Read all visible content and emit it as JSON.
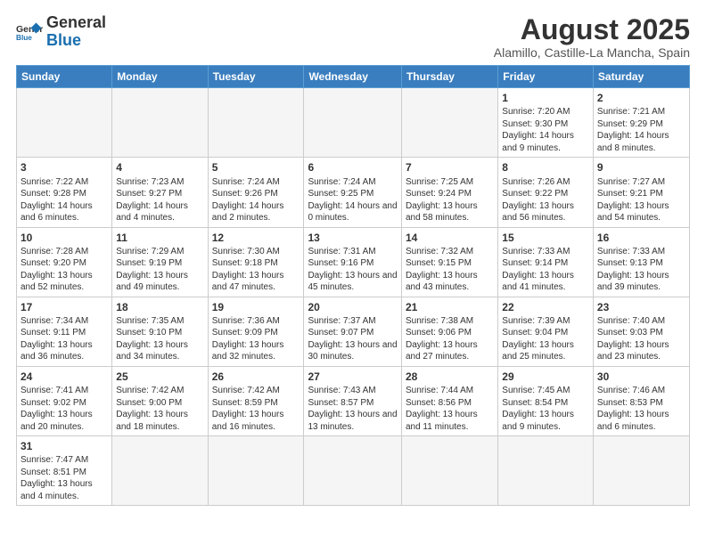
{
  "logo": {
    "text_general": "General",
    "text_blue": "Blue"
  },
  "title": "August 2025",
  "location": "Alamillo, Castille-La Mancha, Spain",
  "weekdays": [
    "Sunday",
    "Monday",
    "Tuesday",
    "Wednesday",
    "Thursday",
    "Friday",
    "Saturday"
  ],
  "weeks": [
    [
      {
        "day": "",
        "info": ""
      },
      {
        "day": "",
        "info": ""
      },
      {
        "day": "",
        "info": ""
      },
      {
        "day": "",
        "info": ""
      },
      {
        "day": "",
        "info": ""
      },
      {
        "day": "1",
        "info": "Sunrise: 7:20 AM\nSunset: 9:30 PM\nDaylight: 14 hours and 9 minutes."
      },
      {
        "day": "2",
        "info": "Sunrise: 7:21 AM\nSunset: 9:29 PM\nDaylight: 14 hours and 8 minutes."
      }
    ],
    [
      {
        "day": "3",
        "info": "Sunrise: 7:22 AM\nSunset: 9:28 PM\nDaylight: 14 hours and 6 minutes."
      },
      {
        "day": "4",
        "info": "Sunrise: 7:23 AM\nSunset: 9:27 PM\nDaylight: 14 hours and 4 minutes."
      },
      {
        "day": "5",
        "info": "Sunrise: 7:24 AM\nSunset: 9:26 PM\nDaylight: 14 hours and 2 minutes."
      },
      {
        "day": "6",
        "info": "Sunrise: 7:24 AM\nSunset: 9:25 PM\nDaylight: 14 hours and 0 minutes."
      },
      {
        "day": "7",
        "info": "Sunrise: 7:25 AM\nSunset: 9:24 PM\nDaylight: 13 hours and 58 minutes."
      },
      {
        "day": "8",
        "info": "Sunrise: 7:26 AM\nSunset: 9:22 PM\nDaylight: 13 hours and 56 minutes."
      },
      {
        "day": "9",
        "info": "Sunrise: 7:27 AM\nSunset: 9:21 PM\nDaylight: 13 hours and 54 minutes."
      }
    ],
    [
      {
        "day": "10",
        "info": "Sunrise: 7:28 AM\nSunset: 9:20 PM\nDaylight: 13 hours and 52 minutes."
      },
      {
        "day": "11",
        "info": "Sunrise: 7:29 AM\nSunset: 9:19 PM\nDaylight: 13 hours and 49 minutes."
      },
      {
        "day": "12",
        "info": "Sunrise: 7:30 AM\nSunset: 9:18 PM\nDaylight: 13 hours and 47 minutes."
      },
      {
        "day": "13",
        "info": "Sunrise: 7:31 AM\nSunset: 9:16 PM\nDaylight: 13 hours and 45 minutes."
      },
      {
        "day": "14",
        "info": "Sunrise: 7:32 AM\nSunset: 9:15 PM\nDaylight: 13 hours and 43 minutes."
      },
      {
        "day": "15",
        "info": "Sunrise: 7:33 AM\nSunset: 9:14 PM\nDaylight: 13 hours and 41 minutes."
      },
      {
        "day": "16",
        "info": "Sunrise: 7:33 AM\nSunset: 9:13 PM\nDaylight: 13 hours and 39 minutes."
      }
    ],
    [
      {
        "day": "17",
        "info": "Sunrise: 7:34 AM\nSunset: 9:11 PM\nDaylight: 13 hours and 36 minutes."
      },
      {
        "day": "18",
        "info": "Sunrise: 7:35 AM\nSunset: 9:10 PM\nDaylight: 13 hours and 34 minutes."
      },
      {
        "day": "19",
        "info": "Sunrise: 7:36 AM\nSunset: 9:09 PM\nDaylight: 13 hours and 32 minutes."
      },
      {
        "day": "20",
        "info": "Sunrise: 7:37 AM\nSunset: 9:07 PM\nDaylight: 13 hours and 30 minutes."
      },
      {
        "day": "21",
        "info": "Sunrise: 7:38 AM\nSunset: 9:06 PM\nDaylight: 13 hours and 27 minutes."
      },
      {
        "day": "22",
        "info": "Sunrise: 7:39 AM\nSunset: 9:04 PM\nDaylight: 13 hours and 25 minutes."
      },
      {
        "day": "23",
        "info": "Sunrise: 7:40 AM\nSunset: 9:03 PM\nDaylight: 13 hours and 23 minutes."
      }
    ],
    [
      {
        "day": "24",
        "info": "Sunrise: 7:41 AM\nSunset: 9:02 PM\nDaylight: 13 hours and 20 minutes."
      },
      {
        "day": "25",
        "info": "Sunrise: 7:42 AM\nSunset: 9:00 PM\nDaylight: 13 hours and 18 minutes."
      },
      {
        "day": "26",
        "info": "Sunrise: 7:42 AM\nSunset: 8:59 PM\nDaylight: 13 hours and 16 minutes."
      },
      {
        "day": "27",
        "info": "Sunrise: 7:43 AM\nSunset: 8:57 PM\nDaylight: 13 hours and 13 minutes."
      },
      {
        "day": "28",
        "info": "Sunrise: 7:44 AM\nSunset: 8:56 PM\nDaylight: 13 hours and 11 minutes."
      },
      {
        "day": "29",
        "info": "Sunrise: 7:45 AM\nSunset: 8:54 PM\nDaylight: 13 hours and 9 minutes."
      },
      {
        "day": "30",
        "info": "Sunrise: 7:46 AM\nSunset: 8:53 PM\nDaylight: 13 hours and 6 minutes."
      }
    ],
    [
      {
        "day": "31",
        "info": "Sunrise: 7:47 AM\nSunset: 8:51 PM\nDaylight: 13 hours and 4 minutes."
      },
      {
        "day": "",
        "info": ""
      },
      {
        "day": "",
        "info": ""
      },
      {
        "day": "",
        "info": ""
      },
      {
        "day": "",
        "info": ""
      },
      {
        "day": "",
        "info": ""
      },
      {
        "day": "",
        "info": ""
      }
    ]
  ]
}
